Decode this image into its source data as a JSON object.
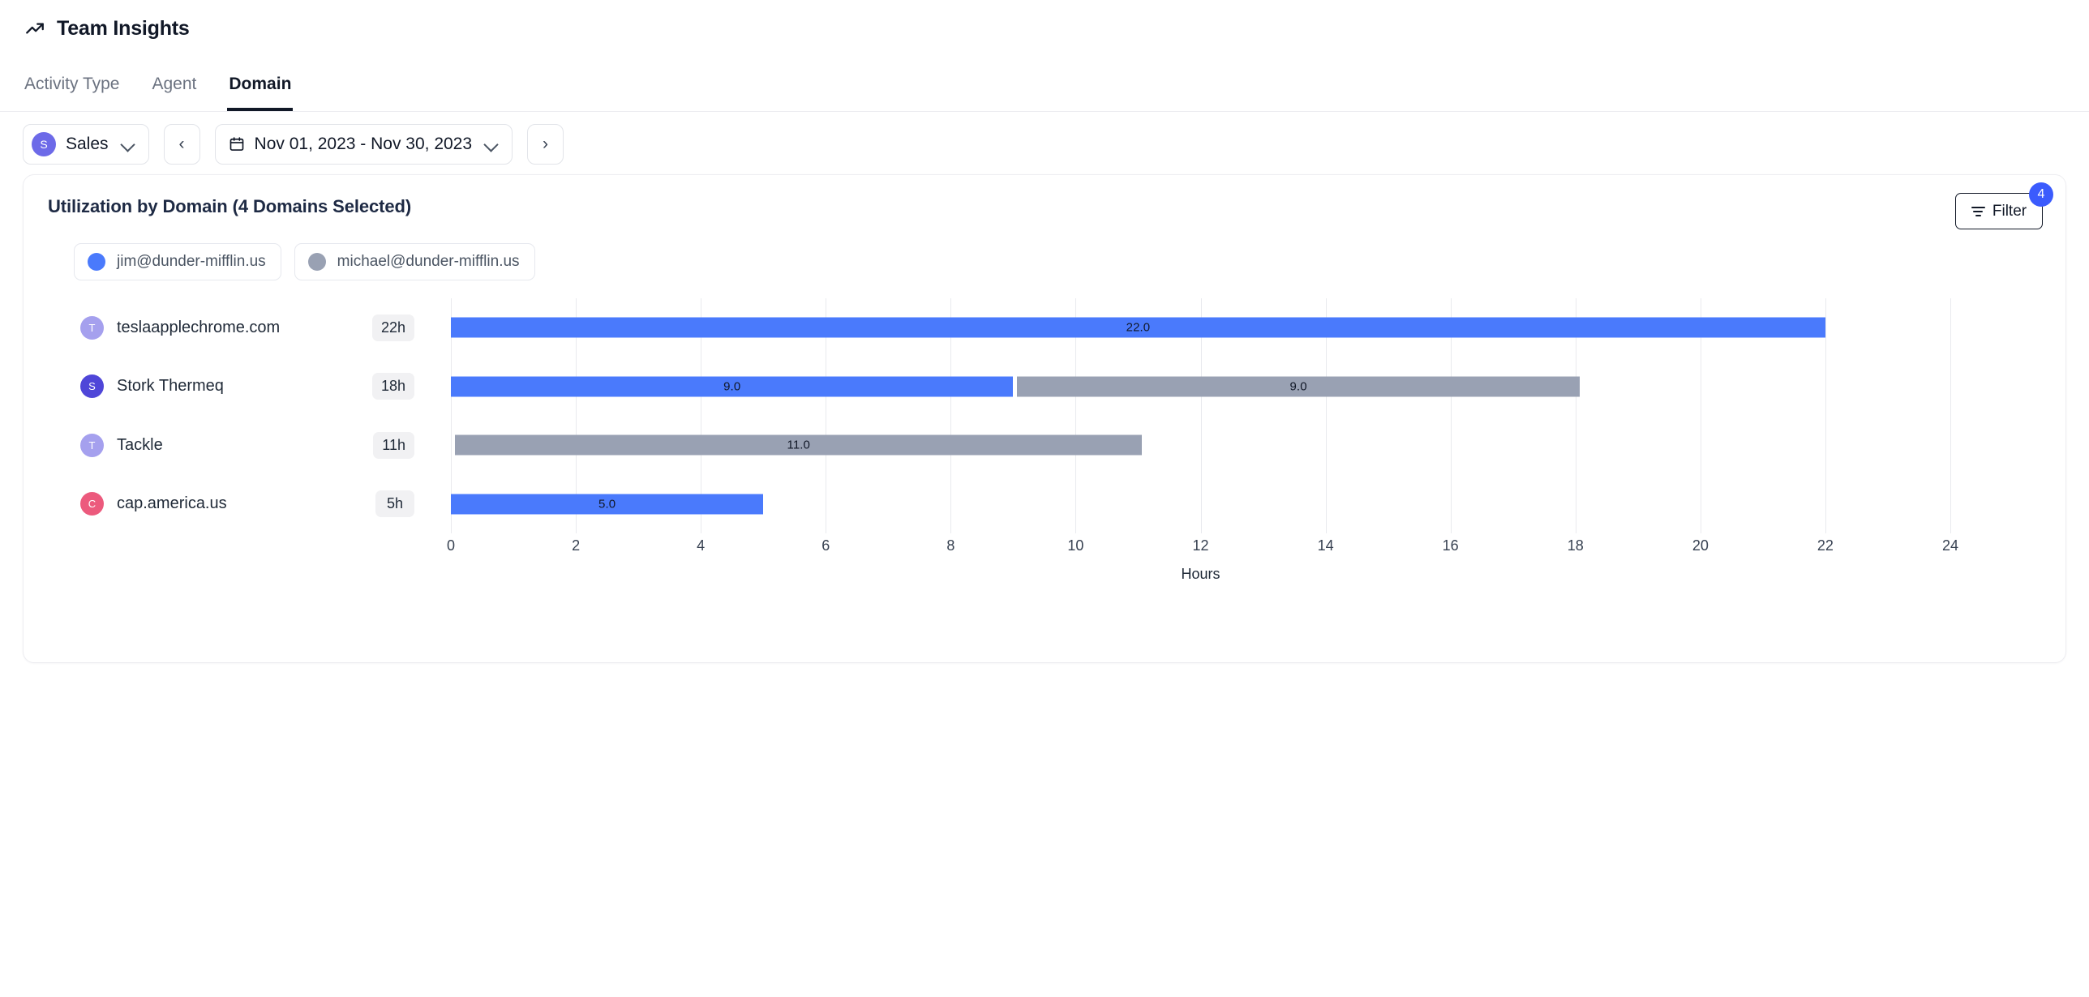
{
  "header": {
    "title": "Team Insights",
    "icon": "trending-up-icon"
  },
  "tabs": [
    {
      "label": "Activity Type",
      "active": false
    },
    {
      "label": "Agent",
      "active": false
    },
    {
      "label": "Domain",
      "active": true
    }
  ],
  "toolbar": {
    "team": {
      "initial": "S",
      "name": "Sales",
      "avatar_color": "#6d6ae8"
    },
    "prev_label": "‹",
    "next_label": "›",
    "date_range": "Nov 01, 2023 - Nov 30, 2023",
    "calendar_icon": "calendar-icon",
    "chevron_icon": "chevron-down-icon"
  },
  "card": {
    "title": "Utilization by Domain (4 Domains Selected)",
    "filter": {
      "label": "Filter",
      "badge": "4",
      "badge_color": "#3b5bfd",
      "icon": "filter-icon"
    }
  },
  "legend": [
    {
      "label": "jim@dunder-mifflin.us",
      "color": "#4a7afc"
    },
    {
      "label": "michael@dunder-mifflin.us",
      "color": "#99a1b3"
    }
  ],
  "rows": [
    {
      "initial": "T",
      "avatar_color": "#a5a0ee",
      "name": "teslaapplechrome.com",
      "hours_pill": "22h"
    },
    {
      "initial": "S",
      "avatar_color": "#4f46d8",
      "name": "Stork Thermeq",
      "hours_pill": "18h"
    },
    {
      "initial": "T",
      "avatar_color": "#a5a0ee",
      "name": "Tackle",
      "hours_pill": "11h"
    },
    {
      "initial": "C",
      "avatar_color": "#ec5a7d",
      "name": "cap.america.us",
      "hours_pill": "5h"
    }
  ],
  "chart_data": {
    "type": "bar",
    "orientation": "horizontal",
    "stacked": true,
    "title": "Utilization by Domain (4 Domains Selected)",
    "xlabel": "Hours",
    "ylabel": "",
    "xlim": [
      0,
      24
    ],
    "xticks": [
      0,
      2,
      4,
      6,
      8,
      10,
      12,
      14,
      16,
      18,
      20,
      22,
      24
    ],
    "xtick_labels": [
      "0",
      "2",
      "4",
      "6",
      "8",
      "10",
      "12",
      "14",
      "16",
      "18",
      "20",
      "22",
      "24"
    ],
    "grid": "vertical",
    "legend_position": "top-left",
    "categories": [
      "teslaapplechrome.com",
      "Stork Thermeq",
      "Tackle",
      "cap.america.us"
    ],
    "series": [
      {
        "name": "jim@dunder-mifflin.us",
        "color": "#4a7afc",
        "values": [
          22.0,
          9.0,
          0,
          5.0
        ]
      },
      {
        "name": "michael@dunder-mifflin.us",
        "color": "#99a1b3",
        "values": [
          0,
          9.0,
          11.0,
          0
        ]
      }
    ],
    "bar_labels": [
      [
        "22.0",
        ""
      ],
      [
        "9.0",
        "9.0"
      ],
      [
        "",
        "11.0"
      ],
      [
        "5.0",
        ""
      ]
    ],
    "totals": [
      22,
      18,
      11,
      5
    ]
  }
}
